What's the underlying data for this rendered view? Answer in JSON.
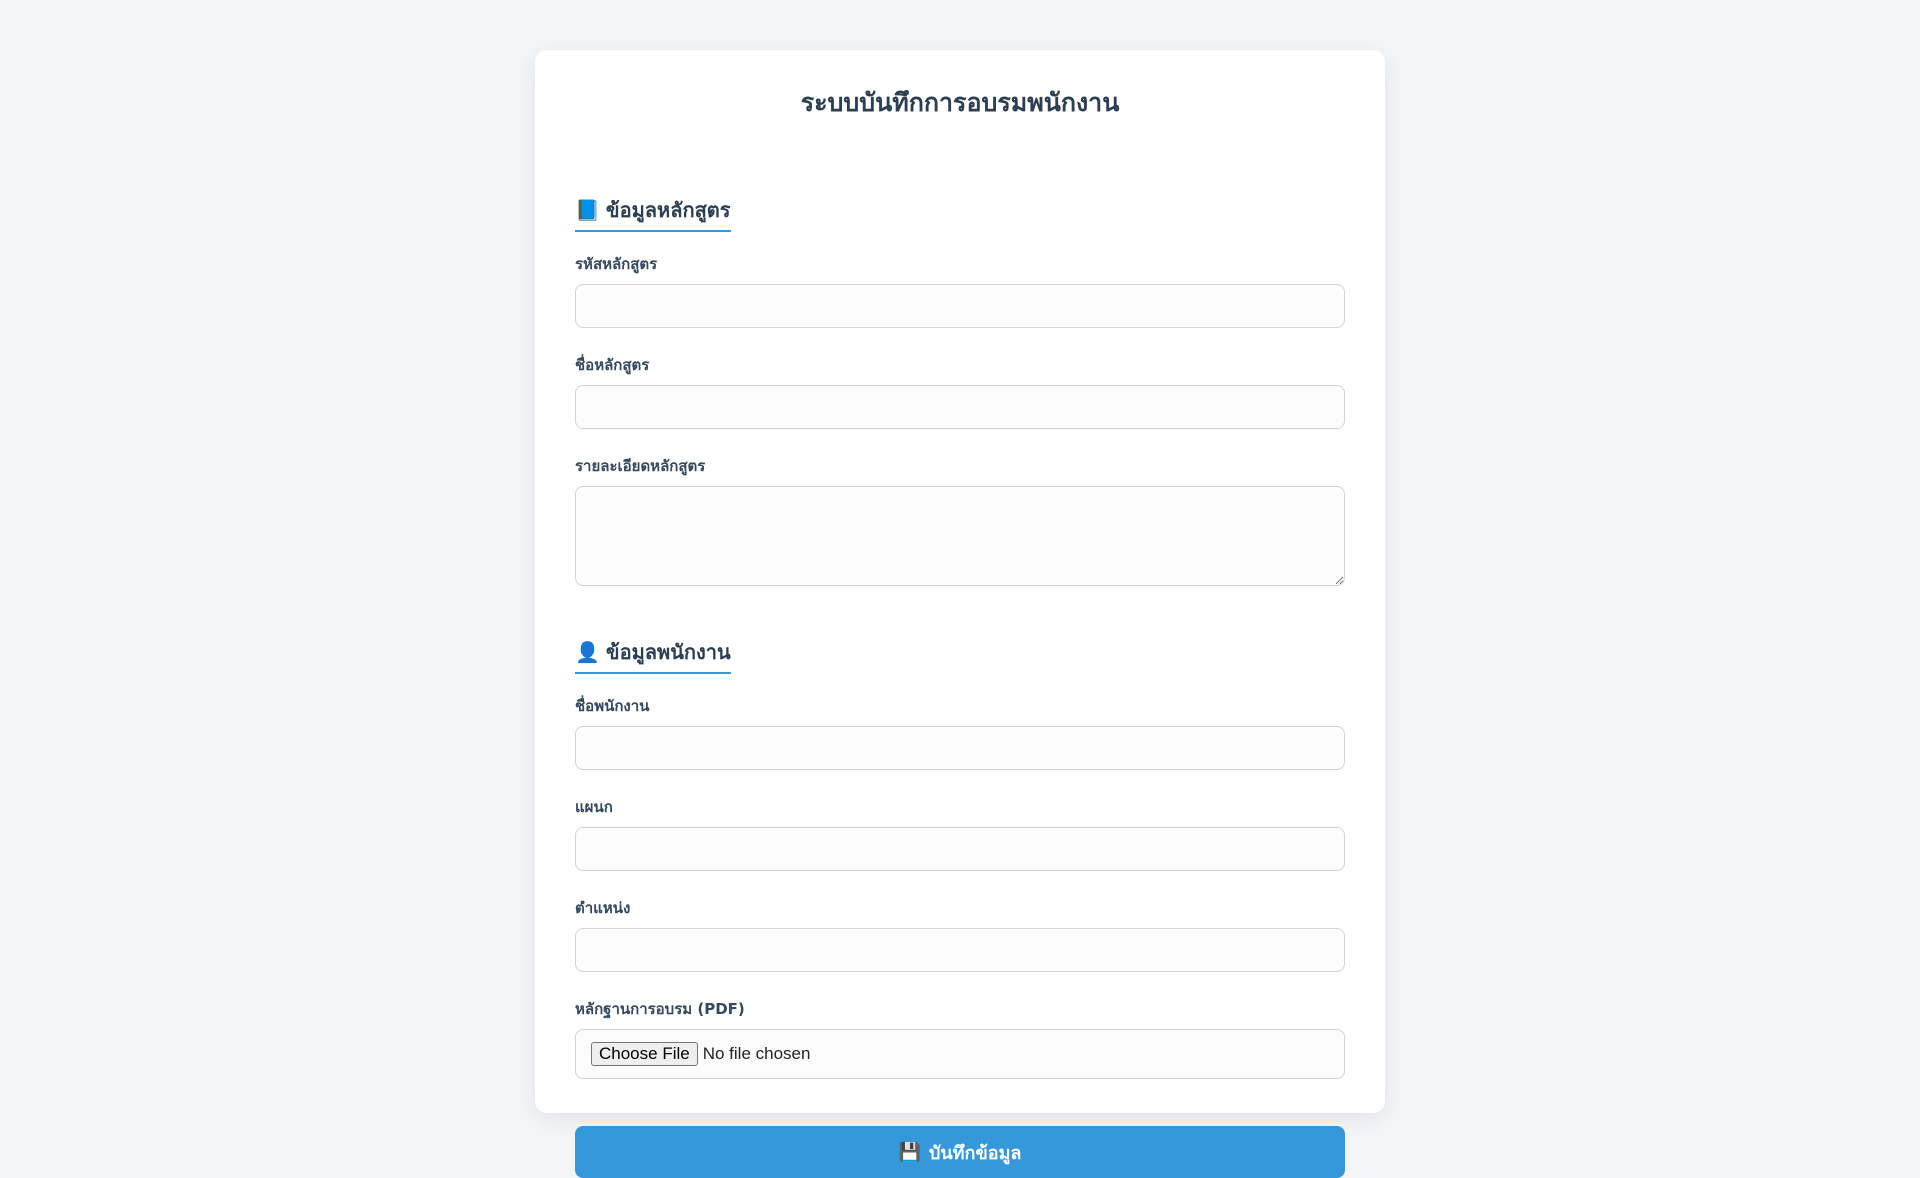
{
  "title": "ระบบบันทึกการอบรมพนักงาน",
  "course_section": {
    "icon": "book-icon",
    "icon_glyph": "📘",
    "heading": "ข้อมูลหลักสูตร",
    "course_code_label": "รหัสหลักสูตร",
    "course_name_label": "ชื่อหลักสูตร",
    "course_detail_label": "รายละเอียดหลักสูตร"
  },
  "employee_section": {
    "icon": "user-icon",
    "icon_glyph": "👤",
    "heading": "ข้อมูลพนักงาน",
    "employee_name_label": "ชื่อพนักงาน",
    "department_label": "แผนก",
    "position_label": "ตำแหน่ง",
    "evidence_label": "หลักฐานการอบรม (PDF)",
    "file_button_label": "Choose File",
    "file_status": "No file chosen"
  },
  "submit": {
    "icon": "floppy-disk-icon",
    "icon_glyph": "💾",
    "label": "บันทึกข้อมูล"
  },
  "colors": {
    "accent": "#3498db",
    "background": "#f4f5f7",
    "heading": "#2c3e50"
  }
}
